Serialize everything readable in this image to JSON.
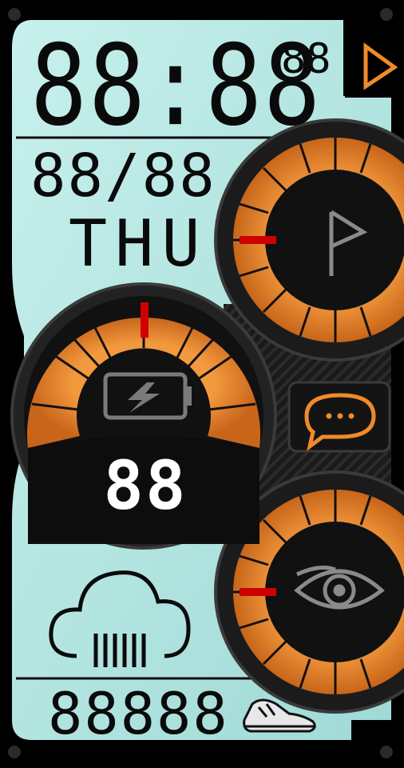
{
  "time": {
    "hm": "88:88",
    "seconds": "88"
  },
  "date": {
    "value": "88/88",
    "weekday": "THU"
  },
  "battery": {
    "percent_value": "88"
  },
  "steps": {
    "value": "88888"
  },
  "colors": {
    "lcd": "#a9e3df",
    "lcd_light": "#c9f2ee",
    "orange": "#f08a2a",
    "orange_dark": "#b85a12",
    "bezel": "#1c1c1c",
    "accent_red": "#d10000"
  },
  "icons": {
    "play": "play-triangle-icon",
    "battery": "battery-charging-icon",
    "notification": "chat-bubble-icon",
    "weather": "cloud-rain-icon",
    "steps": "sneaker-icon",
    "top_gauge": "flag-icon",
    "bottom_gauge": "eye-icon"
  }
}
